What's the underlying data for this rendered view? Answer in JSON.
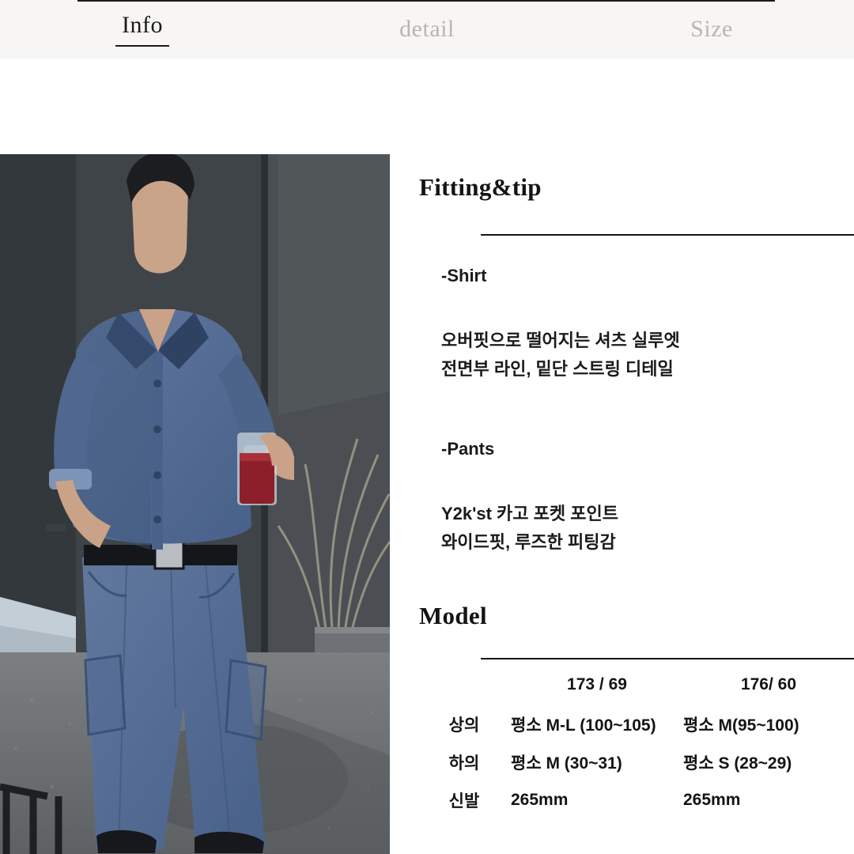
{
  "tabs": [
    {
      "label": "Info",
      "active": true
    },
    {
      "label": "detail",
      "active": false
    },
    {
      "label": "Size",
      "active": false
    }
  ],
  "sections": {
    "fitting": {
      "title": "Fitting&tip",
      "shirt_heading": "-Shirt",
      "shirt_line1": "오버핏으로 떨어지는 셔츠 실루엣",
      "shirt_line2": "전면부 라인, 밑단 스트링 디테일",
      "pants_heading": "-Pants",
      "pants_line1": "Y2k'st 카고 포켓 포인트",
      "pants_line2": "와이드핏, 루즈한 피팅감"
    },
    "model": {
      "title": "Model",
      "columns": [
        "",
        "173 / 69",
        "176/ 60"
      ],
      "rows": [
        {
          "label": "상의",
          "a": "평소 M-L (100~105)",
          "b": "평소 M(95~100)"
        },
        {
          "label": "하의",
          "a": "평소 M (30~31)",
          "b": "평소 S (28~29)"
        },
        {
          "label": "신발",
          "a": "265mm",
          "b": "265mm"
        }
      ]
    }
  },
  "photo": {
    "alt": "Model wearing denim short-sleeve shirt and wide cargo denim pants holding an iced drink",
    "colors": {
      "denim": "#5a739a",
      "denim_dark": "#3c5171",
      "wall": "#42464b",
      "ground": "#6f7377",
      "sky_panel": "#b6c2cb",
      "drink": "#8c1f2a"
    }
  },
  "theme": {
    "tabbar_bg": "#f7f6f4",
    "text": "#141414",
    "muted": "#b9b5b0"
  }
}
